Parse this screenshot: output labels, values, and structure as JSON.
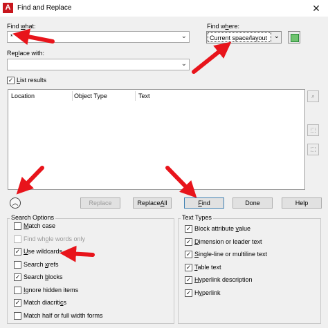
{
  "window": {
    "title": "Find and Replace",
    "app_icon": "A",
    "close_glyph": "✕"
  },
  "find_what": {
    "label_pre": "Find ",
    "label_ul": "w",
    "label_post": "hat:",
    "value": "*"
  },
  "find_where": {
    "label_pre": "Find w",
    "label_ul": "h",
    "label_post": "ere:",
    "value": "Current space/layout"
  },
  "replace_with": {
    "label_pre": "Re",
    "label_ul": "p",
    "label_post": "lace with:",
    "value": ""
  },
  "list_results": {
    "label_ul": "L",
    "label_post": "ist results",
    "checked": true
  },
  "results_columns": [
    "Location",
    "Object Type",
    "Text"
  ],
  "buttons": {
    "replace": "Replace",
    "replace_all_pre": "Replace ",
    "replace_all_ul": "A",
    "replace_all_post": "ll",
    "find_ul": "F",
    "find_post": "ind",
    "done": "Done",
    "help": "Help"
  },
  "search_options": {
    "title": "Search Options",
    "items": [
      {
        "pre": "",
        "ul": "M",
        "post": "atch case",
        "checked": false,
        "disabled": false
      },
      {
        "pre": "Find wh",
        "ul": "o",
        "post": "le words only",
        "checked": false,
        "disabled": true
      },
      {
        "pre": "",
        "ul": "U",
        "post": "se wildcards",
        "checked": true,
        "disabled": false
      },
      {
        "pre": "Search ",
        "ul": "x",
        "post": "refs",
        "checked": false,
        "disabled": false
      },
      {
        "pre": "Search ",
        "ul": "b",
        "post": "locks",
        "checked": true,
        "disabled": false
      },
      {
        "pre": "",
        "ul": "I",
        "post": "gnore hidden items",
        "checked": false,
        "disabled": false
      },
      {
        "pre": "Match diacriti",
        "ul": "c",
        "post": "s",
        "checked": true,
        "disabled": false
      },
      {
        "pre": "Match half or full width forms",
        "ul": "",
        "post": "",
        "checked": false,
        "disabled": false
      }
    ]
  },
  "text_types": {
    "title": "Text Types",
    "items": [
      {
        "pre": "Block attribute ",
        "ul": "v",
        "post": "alue",
        "checked": true
      },
      {
        "pre": "",
        "ul": "D",
        "post": "imension or leader text",
        "checked": true
      },
      {
        "pre": "",
        "ul": "S",
        "post": "ingle-line or multiline text",
        "checked": true
      },
      {
        "pre": "",
        "ul": "T",
        "post": "able text",
        "checked": true
      },
      {
        "pre": "",
        "ul": "H",
        "post": "yperlink description",
        "checked": true
      },
      {
        "pre": "H",
        "ul": "y",
        "post": "perlink",
        "checked": true
      }
    ]
  },
  "colors": {
    "arrow_red": "#e8141b",
    "title_icon_red": "#c8161d"
  }
}
